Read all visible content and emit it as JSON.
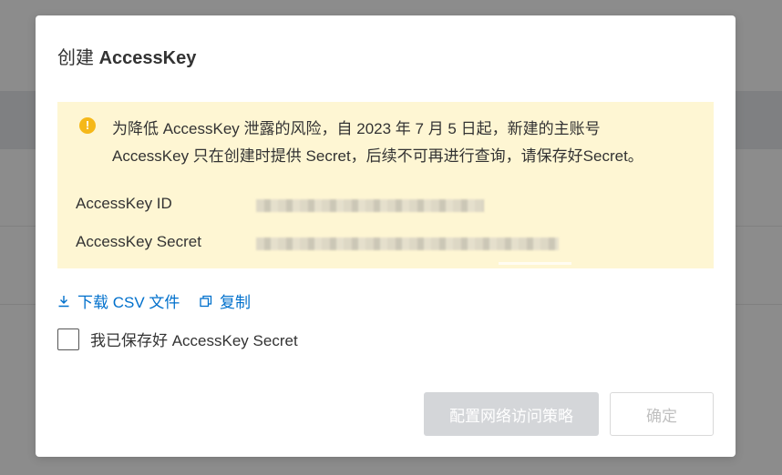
{
  "modal": {
    "title_prefix": "创建",
    "title_main": "AccessKey"
  },
  "alert": {
    "icon": "warning-icon",
    "line1": "为降低 AccessKey 泄露的风险，自 2023 年 7 月 5 日起，新建的主账号",
    "line2": "AccessKey 只在创建时提供 Secret，后续不可再进行查询，请保存好Secret。",
    "id_label": "AccessKey ID",
    "secret_label": "AccessKey Secret"
  },
  "actions": {
    "download_label": "下载 CSV 文件",
    "copy_label": "复制"
  },
  "confirm": {
    "checkbox_label": "我已保存好 AccessKey Secret",
    "checked": false
  },
  "footer": {
    "policy_button": "配置网络访问策略",
    "ok_button": "确定"
  },
  "colors": {
    "link": "#0070cc",
    "alert_bg": "#fef6d3",
    "warning": "#f5b819",
    "disabled_button": "#d4d6d9"
  }
}
